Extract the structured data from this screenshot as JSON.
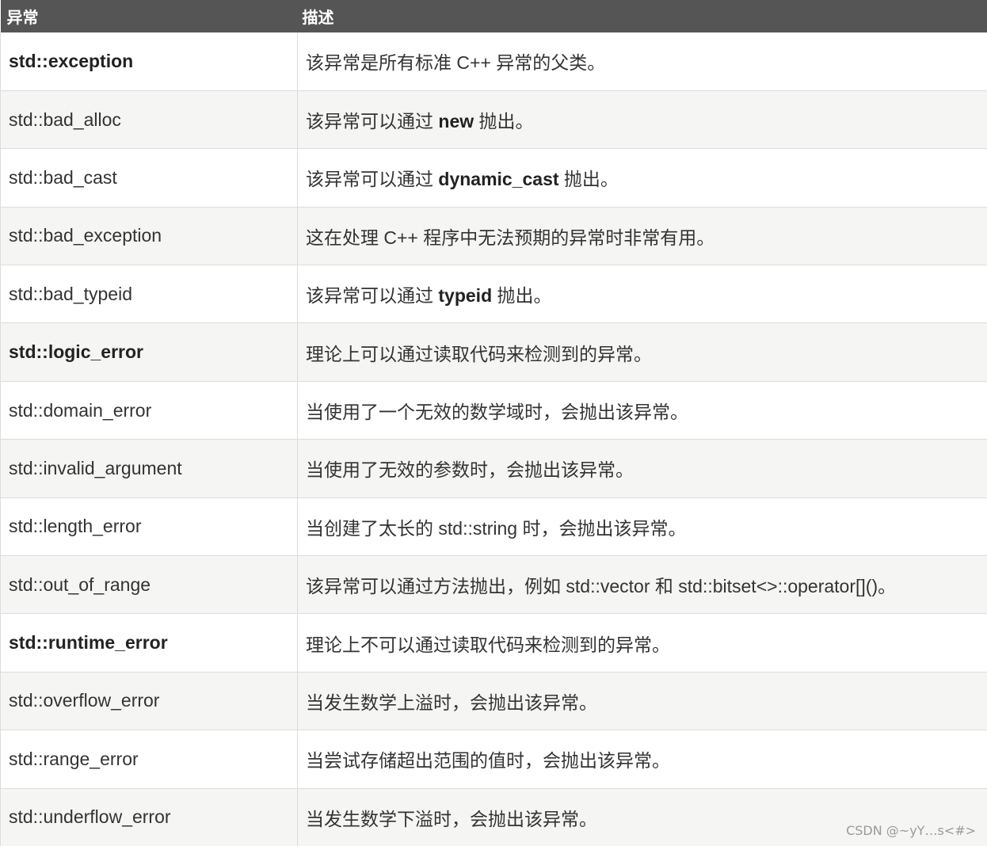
{
  "header": {
    "col1": "异常",
    "col2": "描述"
  },
  "rows": [
    {
      "name": "std::exception",
      "bold": true,
      "desc": [
        "该异常是所有标准 C++ 异常的父类。"
      ]
    },
    {
      "name": "std::bad_alloc",
      "bold": false,
      "desc": [
        "该异常可以通过 ",
        "new",
        " 抛出。"
      ]
    },
    {
      "name": "std::bad_cast",
      "bold": false,
      "desc": [
        "该异常可以通过 ",
        "dynamic_cast",
        " 抛出。"
      ]
    },
    {
      "name": "std::bad_exception",
      "bold": false,
      "desc": [
        "这在处理 C++ 程序中无法预期的异常时非常有用。"
      ]
    },
    {
      "name": "std::bad_typeid",
      "bold": false,
      "desc": [
        "该异常可以通过 ",
        "typeid",
        " 抛出。"
      ]
    },
    {
      "name": "std::logic_error",
      "bold": true,
      "desc": [
        "理论上可以通过读取代码来检测到的异常。"
      ]
    },
    {
      "name": "std::domain_error",
      "bold": false,
      "desc": [
        "当使用了一个无效的数学域时，会抛出该异常。"
      ]
    },
    {
      "name": "std::invalid_argument",
      "bold": false,
      "desc": [
        "当使用了无效的参数时，会抛出该异常。"
      ]
    },
    {
      "name": "std::length_error",
      "bold": false,
      "desc": [
        "当创建了太长的 std::string 时，会抛出该异常。"
      ]
    },
    {
      "name": "std::out_of_range",
      "bold": false,
      "desc": [
        "该异常可以通过方法抛出，例如 std::vector 和 std::bitset<>::operator[]()。"
      ]
    },
    {
      "name": "std::runtime_error",
      "bold": true,
      "desc": [
        "理论上不可以通过读取代码来检测到的异常。"
      ]
    },
    {
      "name": "std::overflow_error",
      "bold": false,
      "desc": [
        "当发生数学上溢时，会抛出该异常。"
      ]
    },
    {
      "name": "std::range_error",
      "bold": false,
      "desc": [
        "当尝试存储超出范围的值时，会抛出该异常。"
      ]
    },
    {
      "name": "std::underflow_error",
      "bold": false,
      "desc": [
        "当发生数学下溢时，会抛出该异常。"
      ]
    }
  ],
  "watermark": "CSDN @~yY…s<#>"
}
